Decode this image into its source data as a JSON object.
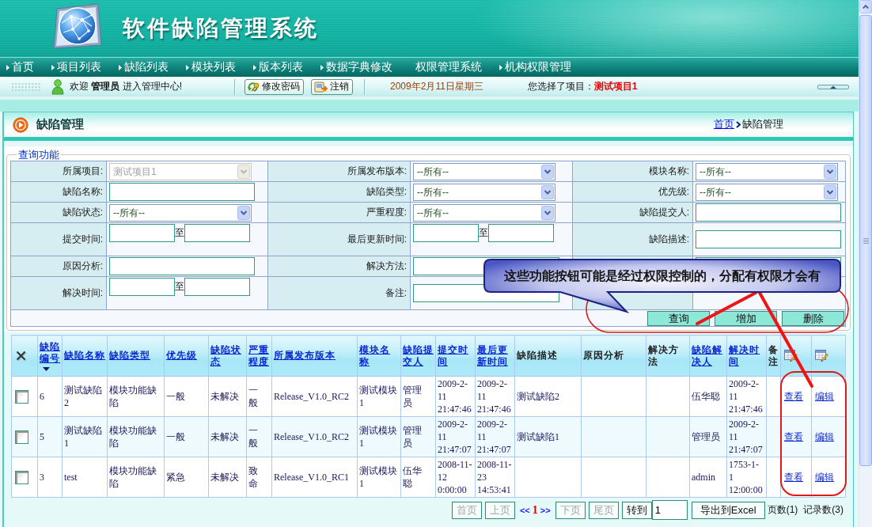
{
  "banner": {
    "title": "软件缺陷管理系统"
  },
  "nav": {
    "items": [
      {
        "label": "首页",
        "bullet": true
      },
      {
        "label": "项目列表",
        "bullet": true
      },
      {
        "label": "缺陷列表",
        "bullet": true
      },
      {
        "label": "模块列表",
        "bullet": true
      },
      {
        "label": "版本列表",
        "bullet": true
      },
      {
        "label": "数据字典修改",
        "bullet": true
      },
      {
        "label": "权限管理系统",
        "bullet": false
      },
      {
        "label": "机构权限管理",
        "bullet": true
      }
    ]
  },
  "user_bar": {
    "welcome": "欢迎 **管理员** 进入管理中心!",
    "buttons": [
      {
        "label": "修改密码",
        "kind": "password"
      },
      {
        "label": "注销",
        "kind": "logout"
      }
    ],
    "date": "2009年2月11日星期三",
    "project_label": "您选择了项目：",
    "project": "测试项目1"
  },
  "panel": {
    "title": "缺陷管理",
    "breadcrumb": [
      {
        "label": "首页",
        "kind": "link"
      },
      {
        "label": "缺陷管理",
        "kind": "current"
      }
    ]
  },
  "query": {
    "legend": "查询功能",
    "rows": [
      [
        {
          "label": "所属项目:",
          "kind": "select",
          "value": "测试项目1",
          "disabled": true
        },
        {
          "label": "所属发布版本:",
          "kind": "select",
          "value": "--所有--",
          "disabled": false
        },
        {
          "label": "模块名称:",
          "kind": "select",
          "value": "--所有--",
          "disabled": false
        }
      ],
      [
        {
          "label": "缺陷名称:",
          "kind": "text"
        },
        {
          "label": "缺陷类型:",
          "kind": "select",
          "value": "--所有--",
          "disabled": false
        },
        {
          "label": "优先级:",
          "kind": "select",
          "value": "--所有--",
          "disabled": false
        }
      ],
      [
        {
          "label": "缺陷状态:",
          "kind": "select",
          "value": "--所有--",
          "disabled": false
        },
        {
          "label": "严重程度:",
          "kind": "select",
          "value": "--所有--",
          "disabled": false
        },
        {
          "label": "缺陷提交人:",
          "kind": "text"
        }
      ],
      [
        {
          "label": "提交时间:",
          "kind": "range",
          "separator": "至"
        },
        {
          "label": "最后更新时间:",
          "kind": "range",
          "separator": "至"
        },
        {
          "label": "缺陷描述:",
          "kind": "text"
        }
      ],
      [
        {
          "label": "原因分析:",
          "kind": "text"
        },
        {
          "label": "解决方法:",
          "kind": "text"
        },
        {
          "kind": "text"
        }
      ],
      [
        {
          "label": "解决时间:",
          "kind": "range",
          "separator": "至"
        },
        {
          "label": "备注:",
          "kind": "text"
        }
      ]
    ],
    "buttons": [
      "查询",
      "增加",
      "删除"
    ]
  },
  "table": {
    "columns": [
      {
        "kind": "select_all"
      },
      {
        "label": "缺陷编号",
        "kind": "link",
        "sorted": true
      },
      {
        "label": "缺陷名称",
        "kind": "link",
        "sorted": false
      },
      {
        "label": "缺陷类型",
        "kind": "link",
        "sorted": false
      },
      {
        "label": "优先级",
        "kind": "link",
        "sorted": false
      },
      {
        "label": "缺陷状态",
        "kind": "link",
        "sorted": false
      },
      {
        "label": "严重程度",
        "kind": "link",
        "sorted": false
      },
      {
        "label": "所属发布版本",
        "kind": "link",
        "sorted": false
      },
      {
        "label": "模块名称",
        "kind": "link",
        "sorted": false
      },
      {
        "label": "缺陷提交人",
        "kind": "link",
        "sorted": false
      },
      {
        "label": "提交时间",
        "kind": "link",
        "sorted": false
      },
      {
        "label": "最后更新时间",
        "kind": "link",
        "sorted": false
      },
      {
        "label": "缺陷描述",
        "kind": "text"
      },
      {
        "label": "原因分析",
        "kind": "text"
      },
      {
        "label": "解决方法",
        "kind": "text"
      },
      {
        "label": "缺陷解决人",
        "kind": "link",
        "sorted": false
      },
      {
        "label": "解决时间",
        "kind": "link",
        "sorted": false
      },
      {
        "label": "备注",
        "kind": "text"
      },
      {
        "kind": "icon"
      },
      {
        "kind": "icon"
      }
    ],
    "rows": [
      {
        "cells": [
          {
            "checked": false
          },
          "6",
          "测试缺陷2",
          "模块功能缺陷",
          "一般",
          "未解决",
          "一般",
          "Release_V1.0_RC2",
          "测试模块1",
          "管理员",
          "2009-2-11 21:47:46",
          "2009-2-11 21:47:46",
          "测试缺陷2",
          null,
          null,
          "伍华聪",
          "2009-2-11 21:47:46",
          null,
          "查看",
          "编辑"
        ]
      },
      {
        "cells": [
          {
            "checked": false
          },
          "5",
          "测试缺陷1",
          "模块功能缺陷",
          "一般",
          "未解决",
          "一般",
          "Release_V1.0_RC2",
          "测试模块1",
          "管理员",
          "2009-2-11 21:47:07",
          "2009-2-11 21:47:07",
          "测试缺陷1",
          null,
          null,
          "管理员",
          "2009-2-11 21:47:07",
          null,
          "查看",
          "编辑"
        ]
      },
      {
        "cells": [
          {
            "checked": false
          },
          "3",
          "test",
          "模块功能缺陷",
          "紧急",
          "未解决",
          "致命",
          "Release_V1.0_RC1",
          "测试模块1",
          "伍华聪",
          "2008-11-12 0:00:00",
          "2008-11-23 14:53:41",
          null,
          null,
          null,
          "admin",
          "1753-1-1 12:00:00",
          null,
          "查看",
          "编辑"
        ]
      }
    ]
  },
  "pager": {
    "first": {
      "label": "首页",
      "disabled": true
    },
    "prev": {
      "label": "上页",
      "disabled": true
    },
    "back": "<<",
    "current": "1",
    "forward": ">>",
    "next": {
      "label": "下页",
      "disabled": true
    },
    "last": {
      "label": "尾页",
      "disabled": true
    },
    "goto": {
      "label": "转到",
      "disabled": false
    },
    "goto_value": "1",
    "export": "导出到Excel",
    "page_count": "页数(1)",
    "record_count": "记录数(3)"
  },
  "annotation": {
    "callout": "这些功能按钮可能是经过权限控制的，分配有权限才会有"
  }
}
